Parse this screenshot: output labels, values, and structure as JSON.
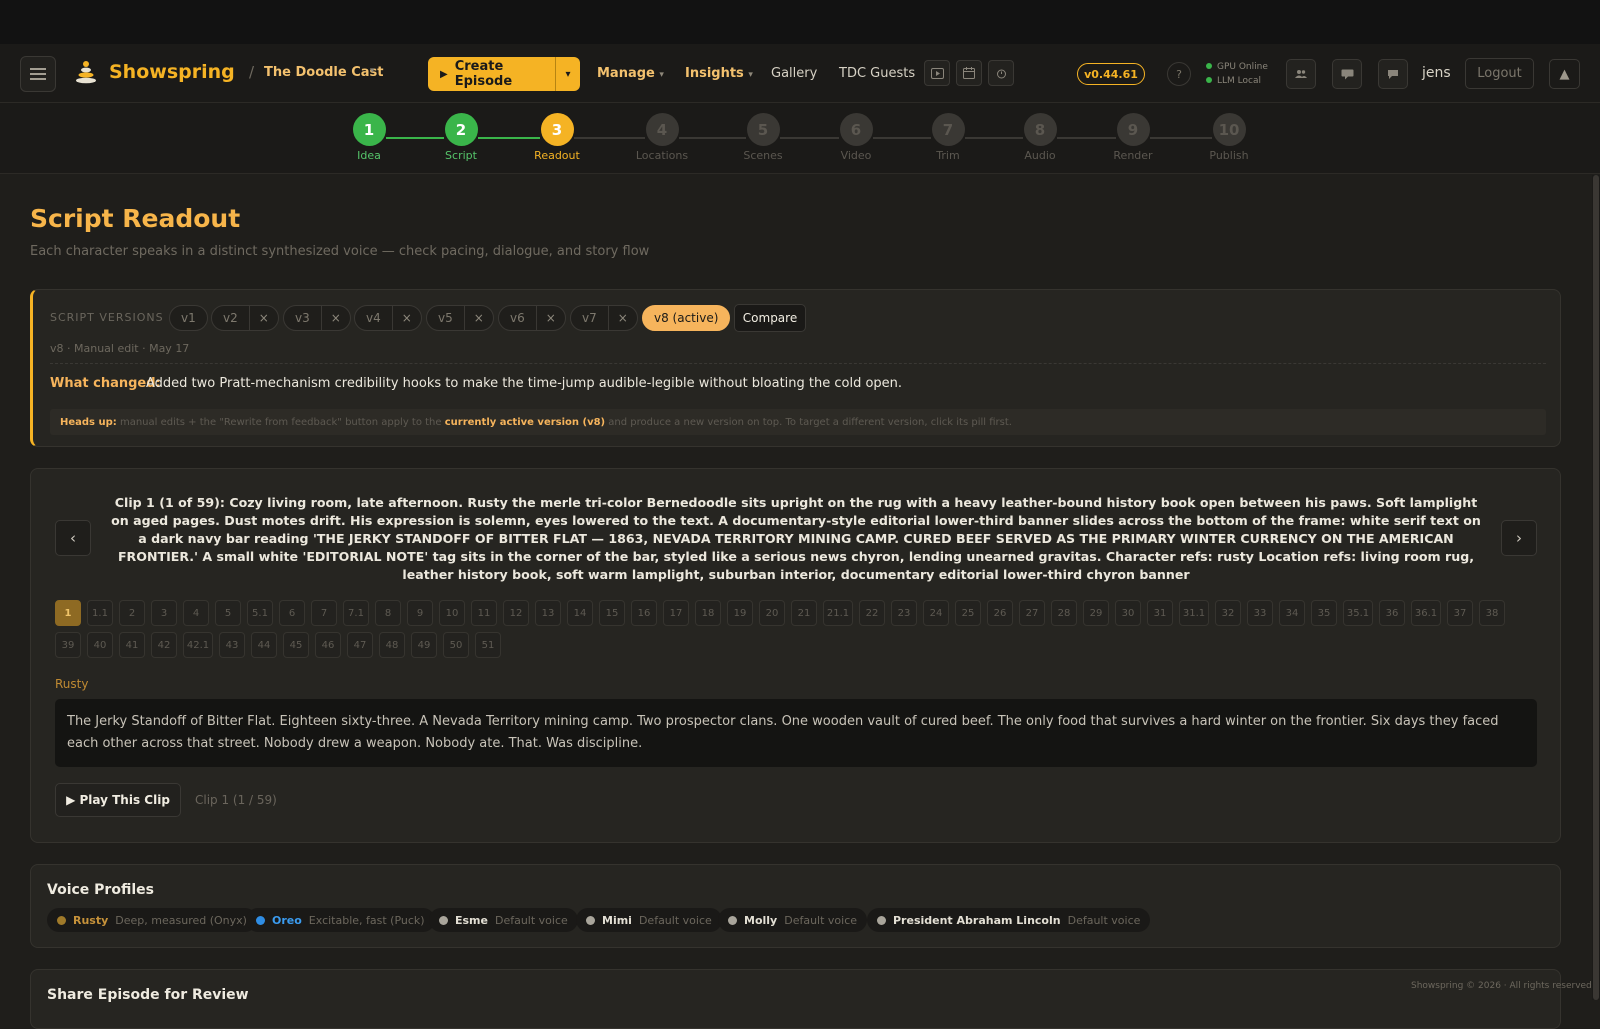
{
  "app": {
    "brand": "Showspring",
    "project": "The Doodle Cast",
    "version": "v0.44.61",
    "user": "jens",
    "logout_label": "Logout",
    "help": "?"
  },
  "nav": {
    "create_label": "Create Episode",
    "manage": "Manage",
    "insights": "Insights",
    "gallery": "Gallery",
    "guests": "TDC Guests"
  },
  "status": {
    "gpu": "GPU Online",
    "llm": "LLM Local"
  },
  "steps": [
    {
      "num": "1",
      "label": "Idea",
      "state": "done"
    },
    {
      "num": "2",
      "label": "Script",
      "state": "done"
    },
    {
      "num": "3",
      "label": "Readout",
      "state": "current"
    },
    {
      "num": "4",
      "label": "Locations",
      "state": "todo"
    },
    {
      "num": "5",
      "label": "Scenes",
      "state": "todo"
    },
    {
      "num": "6",
      "label": "Video",
      "state": "todo"
    },
    {
      "num": "7",
      "label": "Trim",
      "state": "todo"
    },
    {
      "num": "8",
      "label": "Audio",
      "state": "todo"
    },
    {
      "num": "9",
      "label": "Render",
      "state": "todo"
    },
    {
      "num": "10",
      "label": "Publish",
      "state": "todo"
    }
  ],
  "page": {
    "title": "Script Readout",
    "subtitle": "Each character speaks in a distinct synthesized voice — check pacing, dialogue, and story flow"
  },
  "versions": {
    "label": "SCRIPT VERSIONS",
    "items": [
      {
        "name": "v1",
        "closable": false
      },
      {
        "name": "v2",
        "closable": true
      },
      {
        "name": "v3",
        "closable": true
      },
      {
        "name": "v4",
        "closable": true
      },
      {
        "name": "v5",
        "closable": true
      },
      {
        "name": "v6",
        "closable": true
      },
      {
        "name": "v7",
        "closable": true
      }
    ],
    "active": "v8 (active)",
    "close_symbol": "×",
    "compare_label": "Compare",
    "meta": "v8 · Manual edit · May 17",
    "what_changed_label": "What changed:",
    "what_changed": "Added two Pratt-mechanism credibility hooks to make the time-jump audible-legible without bloating the cold open.",
    "headsup_label": "Heads up:",
    "headsup_text_1": " manual edits + the \"Rewrite from feedback\" button apply to the ",
    "headsup_strong": "currently active version (v8)",
    "headsup_text_2": " and produce a new version on top. To target a different version, click its pill first."
  },
  "clip": {
    "prev": "‹",
    "next": "›",
    "title": "Clip 1 (1 of 59): Cozy living room, late afternoon. Rusty the merle tri-color Bernedoodle sits upright on the rug with a heavy leather-bound history book open between his paws. Soft lamplight on aged pages. Dust motes drift. His expression is solemn, eyes lowered to the text. A documentary-style editorial lower-third banner slides across the bottom of the frame: white serif text on a dark navy bar reading 'THE JERKY STANDOFF OF BITTER FLAT — 1863, NEVADA TERRITORY MINING CAMP. CURED BEEF SERVED AS THE PRIMARY WINTER CURRENCY ON THE AMERICAN FRONTIER.' A small white 'EDITORIAL NOTE' tag sits in the corner of the bar, styled like a serious news chyron, lending unearned gravitas. Character refs: rusty Location refs: living room rug, leather history book, soft warm lamplight, suburban interior, documentary editorial lower-third chyron banner",
    "chips": [
      "1",
      "1.1",
      "2",
      "3",
      "4",
      "5",
      "5.1",
      "6",
      "7",
      "7.1",
      "8",
      "9",
      "10",
      "11",
      "12",
      "13",
      "14",
      "15",
      "16",
      "17",
      "18",
      "19",
      "20",
      "21",
      "21.1",
      "22",
      "23",
      "24",
      "25",
      "26",
      "27",
      "28",
      "29",
      "30",
      "31",
      "31.1",
      "32",
      "33",
      "34",
      "35",
      "35.1",
      "36",
      "36.1",
      "37",
      "38",
      "39",
      "40",
      "41",
      "42",
      "42.1",
      "43",
      "44",
      "45",
      "46",
      "47",
      "48",
      "49",
      "50",
      "51"
    ],
    "active_chip": "1",
    "speaker": "Rusty",
    "dialogue": "The Jerky Standoff of Bitter Flat. Eighteen sixty-three. A Nevada Territory mining camp. Two prospector clans. One wooden vault of cured beef. The only food that survives a hard winter on the frontier. Six days they faced each other across that street. Nobody drew a weapon. Nobody ate. That. Was discipline.",
    "play_label": "▶ Play This Clip",
    "counter": "Clip 1 (1 / 59)"
  },
  "voices": {
    "title": "Voice Profiles",
    "items": [
      {
        "name": "Rusty",
        "desc": "Deep, measured (Onyx)",
        "color": "#a07a2a",
        "name_color": "#c6923a"
      },
      {
        "name": "Oreo",
        "desc": "Excitable, fast (Puck)",
        "color": "#2f8de4",
        "name_color": "#3b9cf0"
      },
      {
        "name": "Esme",
        "desc": "Default voice",
        "color": "#a9a59b",
        "name_color": "#e3dfd4"
      },
      {
        "name": "Mimi",
        "desc": "Default voice",
        "color": "#a9a59b",
        "name_color": "#e3dfd4"
      },
      {
        "name": "Molly",
        "desc": "Default voice",
        "color": "#a9a59b",
        "name_color": "#e3dfd4"
      },
      {
        "name": "President Abraham Lincoln",
        "desc": "Default voice",
        "color": "#a9a59b",
        "name_color": "#e3dfd4"
      }
    ]
  },
  "share": {
    "title": "Share Episode for Review"
  },
  "footer": "Showspring © 2026 · All rights reserved",
  "colors": {
    "accent": "#f5b324",
    "done": "#3ab54a",
    "todo": "#3a3834"
  }
}
